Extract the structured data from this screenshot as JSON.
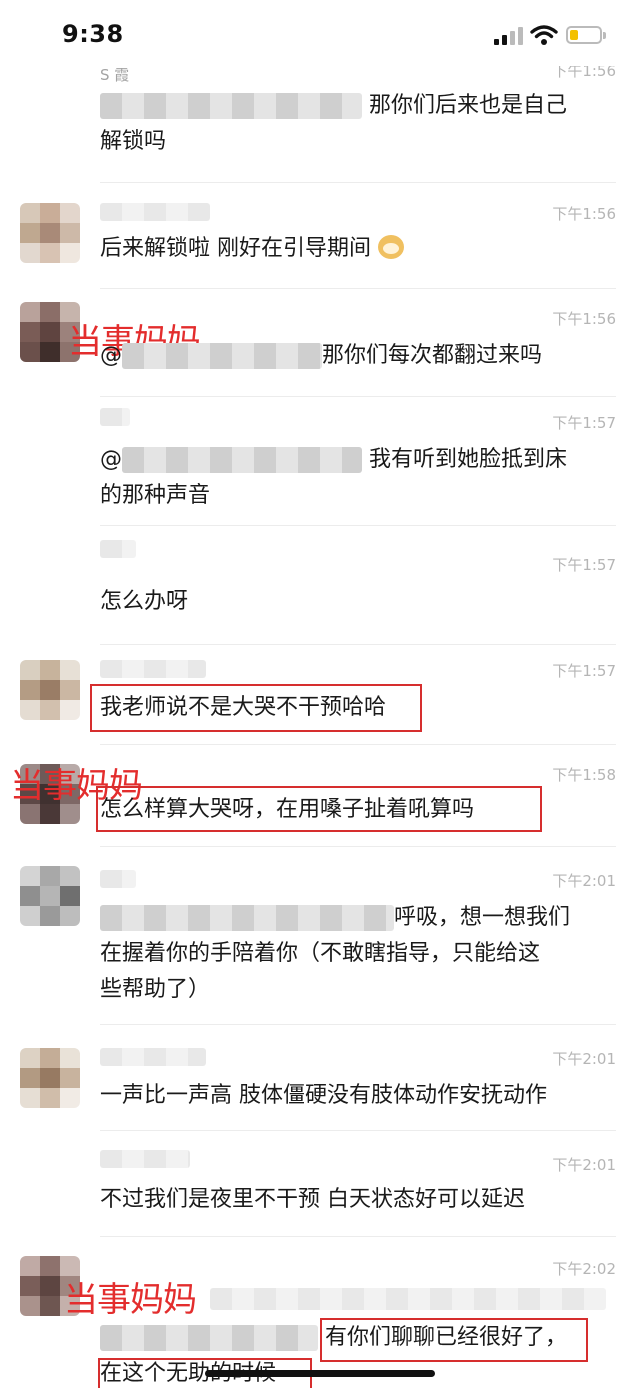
{
  "status": {
    "time": "9:38"
  },
  "annotation_label": "当事妈妈",
  "messages": [
    {
      "name": "S 霞",
      "time": "下午1:56",
      "lines": [
        "那你们后来也是自己",
        "解锁吗"
      ]
    },
    {
      "time": "下午1:56",
      "text": "后来解锁啦 刚好在引导期间"
    },
    {
      "time": "下午1:56",
      "prefix": "@",
      "text": "那你们每次都翻过来吗"
    },
    {
      "time": "下午1:57",
      "prefix": "@",
      "lines": [
        "我有听到她脸抵到床",
        "的那种声音"
      ]
    },
    {
      "time": "下午1:57",
      "text": "怎么办呀"
    },
    {
      "time": "下午1:57",
      "text": "我老师说不是大哭不干预哈哈"
    },
    {
      "time": "下午1:58",
      "text": "怎么样算大哭呀，在用嗓子扯着吼算吗"
    },
    {
      "time": "下午2:01",
      "lines": [
        "呼吸，想一想我们",
        "在握着你的手陪着你（不敢瞎指导，只能给这",
        "些帮助了）"
      ]
    },
    {
      "time": "下午2:01",
      "text": "一声比一声高 肢体僵硬没有肢体动作安抚动作"
    },
    {
      "time": "下午2:01",
      "text": "不过我们是夜里不干预 白天状态好可以延迟"
    },
    {
      "time": "下午2:02",
      "lines": [
        "有你们聊聊已经很好了，",
        "在这个无助的时候"
      ]
    }
  ]
}
